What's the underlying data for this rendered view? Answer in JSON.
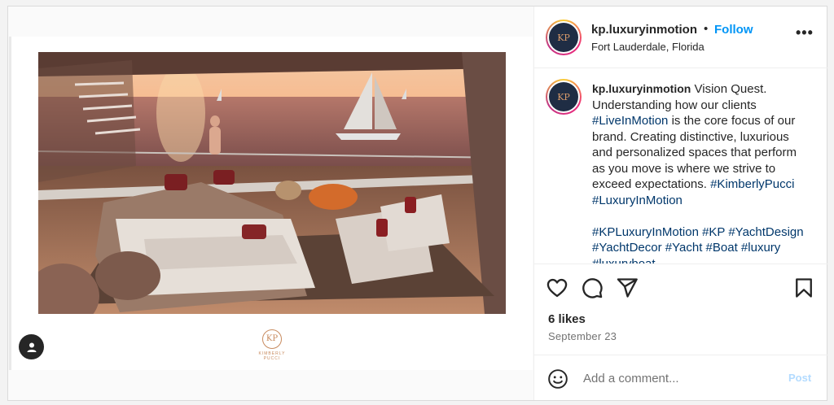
{
  "post": {
    "username": "kp.luxuryinmotion",
    "dot": "•",
    "follow_label": "Follow",
    "location": "Fort Lauderdale, Florida",
    "more_label": "•••",
    "avatar_initials": "KP",
    "caption": {
      "username": "kp.luxuryinmotion",
      "line1": " Vision Quest. Understanding how our clients ",
      "tag1": "#LiveInMotion",
      "line2": " is the core focus of our brand. Creating distinctive, luxurious and personalized spaces that perform as you move is where we strive to exceed expectations. ",
      "tag2": "#KimberlyPucci",
      "tag3": "#LuxuryInMotion",
      "tag4": "#KPLuxuryInMotion",
      "tag5": "#KP",
      "tag6": "#YachtDesign",
      "tag7": "#YachtDecor",
      "tag8": "#Yacht",
      "tag9": "#Boat",
      "tag10": "#luxury",
      "tag11": "#luxuryboat"
    },
    "likes": "6 likes",
    "date": "September 23",
    "comment_placeholder": "Add a comment...",
    "post_label": "Post",
    "brand_logo": {
      "monogram": "KP",
      "name": "KIMBERLY PUCCI"
    }
  },
  "icons": {
    "like": "heart-icon",
    "comment": "comment-icon",
    "share": "share-icon",
    "save": "bookmark-icon",
    "emoji": "emoji-icon",
    "user_tag": "user-tag-icon"
  },
  "colors": {
    "link": "#0095f6",
    "hashtag": "#00376b",
    "post_disabled": "#b3dbff"
  }
}
